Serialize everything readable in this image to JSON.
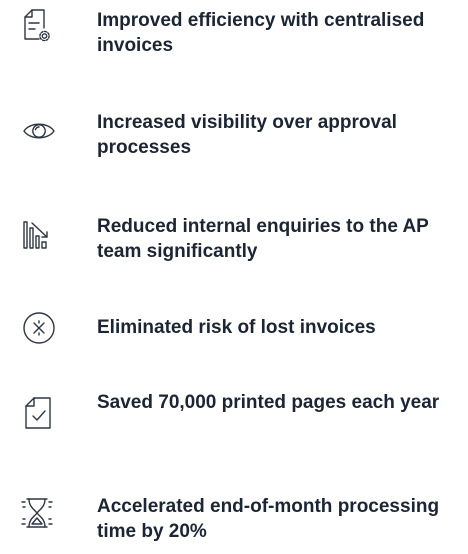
{
  "benefits": [
    {
      "icon": "document-settings-icon",
      "text": "Improved efficiency with centralised invoices"
    },
    {
      "icon": "eye-icon",
      "text": "Increased visibility over approval processes"
    },
    {
      "icon": "chart-bars-icon",
      "text": "Reduced internal enquiries to the AP team significantly"
    },
    {
      "icon": "cross-circle-icon",
      "text": "Eliminated risk of lost invoices"
    },
    {
      "icon": "document-check-icon",
      "text": "Saved 70,000 printed pages each year"
    },
    {
      "icon": "hourglass-icon",
      "text": "Accelerated end-of-month processing time by 20%"
    }
  ],
  "colors": {
    "text": "#1b2533",
    "icon_stroke": "#2d3642",
    "background": "#ffffff"
  }
}
